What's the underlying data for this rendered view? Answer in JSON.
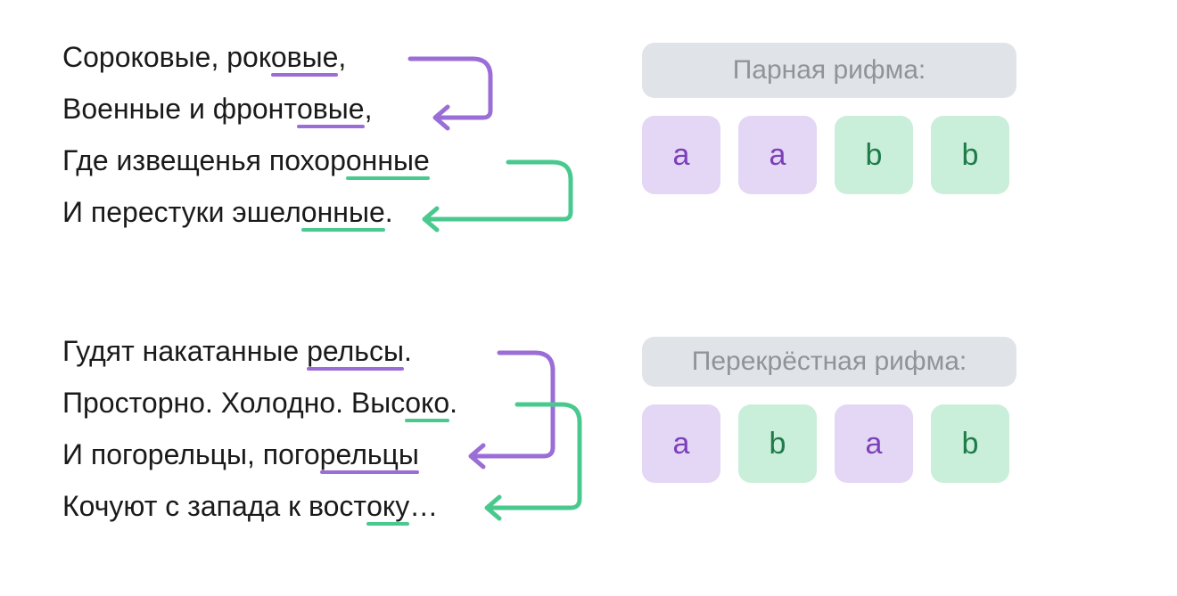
{
  "stanza1": {
    "lines": [
      {
        "pre": "Сороковые, рок",
        "u": "овые",
        "post": ",",
        "uclass": "u-purple"
      },
      {
        "pre": "Военные и фронт",
        "u": "овые",
        "post": ",",
        "uclass": "u-purple"
      },
      {
        "pre": "Где извещенья похор",
        "u": "онные",
        "post": "",
        "uclass": "u-green"
      },
      {
        "pre": "И перестуки эшел",
        "u": "онные",
        "post": ".",
        "uclass": "u-green"
      }
    ],
    "title": "Парная рифма:",
    "scheme": [
      "a",
      "a",
      "b",
      "b"
    ]
  },
  "stanza2": {
    "lines": [
      {
        "pre": "Гудят накатанные ",
        "u": "рельсы",
        "post": ".",
        "uclass": "u-purple"
      },
      {
        "pre": "Просторно. Холодно. Выс",
        "u": "око",
        "post": ".",
        "uclass": "u-green"
      },
      {
        "pre": "И погорельцы, пого",
        "u": "рельцы",
        "post": "",
        "uclass": "u-purple"
      },
      {
        "pre": "Кочуют с запада к вост",
        "u": "оку",
        "post": "…",
        "uclass": "u-green"
      }
    ],
    "title": "Перекрёстная рифма:",
    "scheme": [
      "a",
      "b",
      "a",
      "b"
    ]
  },
  "colors": {
    "purple": "#9b6dd7",
    "green": "#4ac98f"
  }
}
